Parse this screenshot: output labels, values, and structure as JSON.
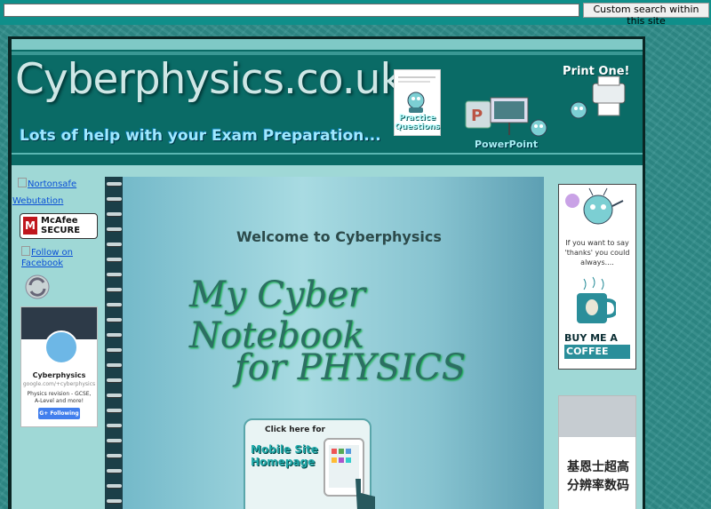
{
  "search": {
    "placeholder": "",
    "value": "",
    "button_label": "Custom search within this site"
  },
  "header": {
    "site_title": "Cyberphysics.co.uk",
    "tagline": "Lots of help with your Exam Preparation...",
    "practice_label": "Practice Questions",
    "powerpoint_label": "PowerPoint",
    "print_label": "Print One!"
  },
  "left_sidebar": {
    "norton_alt": "Nortonsafe",
    "webutation_alt": "Webutation",
    "mcafee_label": "McAfee SECURE",
    "facebook_alt": "Follow on Facebook",
    "gplus": {
      "name": "Cyberphysics",
      "url": "google.com/+cyberphysics",
      "description": "Physics revision - GCSE, A-Level and more!",
      "follow_label": "Following"
    }
  },
  "notebook": {
    "welcome": "Welcome to Cyberphysics",
    "title_line1": "My Cyber Notebook",
    "title_line2": "for PHYSICS",
    "mobile_click": "Click here for",
    "mobile_label": "Mobile Site Homepage"
  },
  "right_sidebar": {
    "coffee_thanks": "If you want to say 'thanks' you could always....",
    "coffee_buy": "BUY ME A",
    "coffee_word": "COFFEE",
    "ad_text": "基恩士超高分辨率数码"
  },
  "colors": {
    "topbar": "#0f8f8a",
    "header": "#0a6b66",
    "sidebar": "#9fd8d6",
    "background": "#2f8d8a"
  }
}
